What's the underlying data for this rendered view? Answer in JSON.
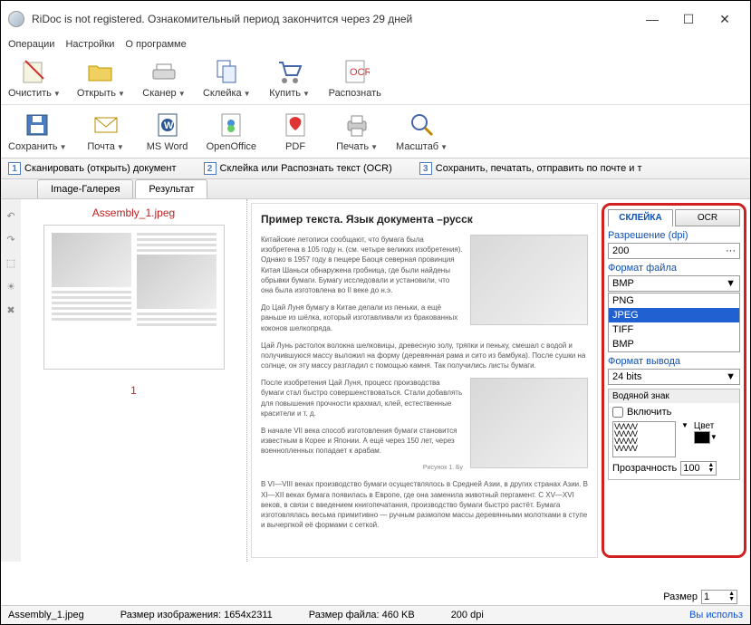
{
  "window": {
    "title": "RiDoc is not registered. Ознакомительный период закончится через 29 дней"
  },
  "menu": {
    "ops": "Операции",
    "settings": "Настройки",
    "about": "О программе"
  },
  "toolbar1": {
    "clear": "Очистить",
    "open": "Открыть",
    "scanner": "Сканер",
    "glue": "Склейка",
    "buy": "Купить",
    "ocr": "Распознать"
  },
  "toolbar2": {
    "save": "Сохранить",
    "mail": "Почта",
    "word": "MS Word",
    "oo": "OpenOffice",
    "pdf": "PDF",
    "print": "Печать",
    "zoom": "Масштаб"
  },
  "steps": {
    "s1": "Сканировать (открыть) документ",
    "s2": "Склейка или Распознать текст (OCR)",
    "s3": "Сохранить, печатать, отправить по почте и т"
  },
  "tabs": {
    "gallery": "Image-Галерея",
    "result": "Результат"
  },
  "thumb": {
    "name": "Assembly_1.jpeg",
    "page": "1"
  },
  "preview": {
    "heading": "Пример текста. Язык документа –русск",
    "p1": "Китайские летописи сообщают, что бумага была изобретена в 105 году н. (см. четыре великих изобретения). Однако в 1957 году в пещере Баоця северная провинция Китая Шаньси обнаружена гробница, где были найдены обрывки бумаги. Бумагу исследовали и установили, что она была изготовлена во II веке до н.э.",
    "p2": "До Цай Луня бумагу в Китае делали из пеньки, а ещё раньше из шёлка, который изготавливали из бракованных коконов шелкопряда.",
    "p3": "Цай Лунь растолок волокна шелковицы, древесную золу, тряпки и пеньку, смешал с водой и получившуюся массу выложил на форму (деревянная рама и сито из бамбука). После сушки на солнце, он эту массу разгладил с помощью камня. Так получились листы бумаги.",
    "p4": "После изобретения Цай Луня, процесс производства бумаги стал быстро совершенствоваться. Стали добавлять для повышения прочности крахмал, клей, естественные красители и т. д.",
    "p5": "В начале VII века способ изготовления бумаги становится известным в Корее и Японии. А ещё через 150 лет, через военнопленных попадает к арабам.",
    "p6": "В VI—VIII веках производство бумаги осуществлялось в Средней Азии, в других странах Азии. В XI—XII веках бумага появилась в Европе, где она заменила животный пергамент. С XV—XVI веков, в связи с введением книгопечатания, производство бумаги быстро растёт. Бумага изготовлялась весьма примитивно — ручным размолом массы деревянными молотками в ступе и вычерпкой её формами с сеткой.",
    "caption": "Рисунок 1. Бу"
  },
  "panel": {
    "tab_glue": "СКЛЕЙКА",
    "tab_ocr": "OCR",
    "res_label": "Разрешение (dpi)",
    "res_value": "200",
    "fmt_label": "Формат файла",
    "fmt_value": "BMP",
    "opts": [
      "PNG",
      "JPEG",
      "TIFF",
      "BMP"
    ],
    "out_label": "Формат вывода",
    "out_value": "24 bits",
    "wm_header": "Водяной знак",
    "wm_enable": "Включить",
    "color_label": "Цвет",
    "opacity_label": "Прозрачность",
    "opacity_value": "100",
    "size_label": "Размер",
    "size_value": "1"
  },
  "status": {
    "file": "Assembly_1.jpeg",
    "dims": "Размер изображения:  1654х2311",
    "size": "Размер файла:  460 KB",
    "dpi": "200 dpi",
    "link": "Вы использ"
  }
}
